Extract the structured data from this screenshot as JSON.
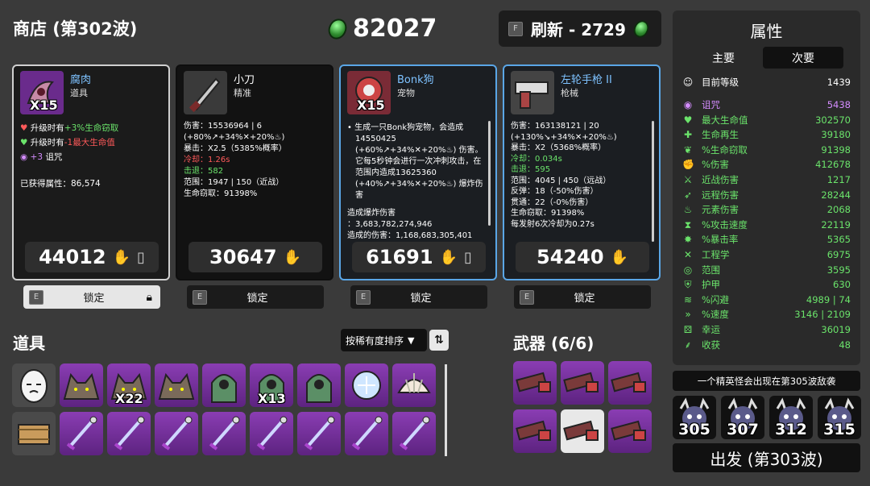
{
  "shop": {
    "title": "商店 (第302波)"
  },
  "gold": {
    "amount": "82027",
    "icon": "green-material-icon"
  },
  "refresh": {
    "key": "F",
    "label": "刷新 - 2729"
  },
  "cards": [
    {
      "name": "腐肉",
      "type": "道具",
      "qty": "X15",
      "rarity": "white",
      "lines": [
        {
          "prefix": "升级时有",
          "value": "+3%生命窃取",
          "value_color": "green",
          "icon": "heart-drain-icon"
        },
        {
          "prefix": "升级时有",
          "value": "-1最大生命值",
          "value_color": "red",
          "icon": "heart-icon"
        },
        {
          "prefix": "+3",
          "value": "诅咒",
          "value_color": "white",
          "icon": "curse-icon"
        }
      ],
      "acquired": "已获得属性：86,574",
      "price": "44012"
    },
    {
      "name": "小刀",
      "type": "精准",
      "rarity": "black",
      "stats": [
        "伤害：15536964 | 6 (+80%↗+34%✕+20%♨)",
        "暴击：X2.5（5385%概率）",
        "冷却：1.26s",
        "击退：582",
        "范围：1947 | 150（近战）",
        "生命窃取：91398%"
      ],
      "price": "30647"
    },
    {
      "name": "Bonk狗",
      "type": "宠物",
      "qty": "X15",
      "rarity": "blue",
      "desc": "生成一只Bonk狗宠物，会造成14550425 (+60%↗+34%✕+20%♨) 伤害。它每5秒钟会进行一次冲刺攻击，在范围内造成13625360 (+40%↗+34%✕+20%♨) 爆炸伤害",
      "dmg_title": "造成爆炸伤害",
      "dmg_value": "：3,683,782,274,946",
      "dealt": "造成的伤害：1,168,683,305,401",
      "price": "61691"
    },
    {
      "name": "左轮手枪 II",
      "type": "枪械",
      "rarity": "blue",
      "stats": [
        "伤害：163138121 | 20 (+130%↘+34%✕+20%♨)",
        "暴击：X2（5368%概率）",
        "冷却：0.034s",
        "击退：595",
        "范围：4045 | 450（远战）",
        "反弹：18（-50%伤害）",
        "贯通：22（-0%伤害）",
        "生命窃取：91398%",
        "每发射6次冷却为0.27s"
      ],
      "price": "54240"
    }
  ],
  "lock": {
    "key": "E",
    "label": "锁定"
  },
  "items_section": {
    "title": "道具",
    "sort_label": "按稀有度排序"
  },
  "weapons_section": {
    "title": "武器 (6/6)"
  },
  "items_row1": [
    {
      "icon": "egg-face-icon",
      "qty": ""
    },
    {
      "icon": "werewolf-icon",
      "qty": ""
    },
    {
      "icon": "werewolf-icon",
      "qty": "X22"
    },
    {
      "icon": "werewolf-icon",
      "qty": ""
    },
    {
      "icon": "green-ghost-icon",
      "qty": ""
    },
    {
      "icon": "green-ghost-icon",
      "qty": "X13"
    },
    {
      "icon": "green-ghost-icon",
      "qty": ""
    },
    {
      "icon": "snowball-icon",
      "qty": ""
    },
    {
      "icon": "shell-icon",
      "qty": ""
    }
  ],
  "items_row2": [
    {
      "icon": "hay-bale-icon"
    },
    {
      "icon": "sword-icon"
    },
    {
      "icon": "sword-icon"
    },
    {
      "icon": "sword-icon"
    },
    {
      "icon": "sword-icon"
    },
    {
      "icon": "sword-icon"
    },
    {
      "icon": "sword-icon"
    },
    {
      "icon": "sword-icon"
    },
    {
      "icon": "sword-icon"
    }
  ],
  "weapons": [
    {
      "icon": "chainsaw-icon"
    },
    {
      "icon": "chainsaw-icon"
    },
    {
      "icon": "chainsaw-icon"
    },
    {
      "icon": "chainsaw-icon"
    },
    {
      "icon": "chainsaw-icon",
      "selected": true
    },
    {
      "icon": "chainsaw-icon"
    }
  ],
  "stats_panel": {
    "title": "属性",
    "tab_main": "主要",
    "tab_secondary": "次要",
    "level_label": "目前等级",
    "level_value": "1439",
    "rows": [
      {
        "name": "诅咒",
        "value": "5438",
        "color": "#d48cff",
        "icon": "curse-icon"
      },
      {
        "name": "最大生命值",
        "value": "302570",
        "color": "#6be46b",
        "icon": "heart-icon"
      },
      {
        "name": "生命再生",
        "value": "39180",
        "color": "#6be46b",
        "icon": "regen-icon"
      },
      {
        "name": "%生命窃取",
        "value": "91398",
        "color": "#6be46b",
        "icon": "lifesteal-icon"
      },
      {
        "name": "%伤害",
        "value": "412678",
        "color": "#6be46b",
        "icon": "damage-icon"
      },
      {
        "name": "近战伤害",
        "value": "1217",
        "color": "#6be46b",
        "icon": "melee-icon"
      },
      {
        "name": "远程伤害",
        "value": "28244",
        "color": "#6be46b",
        "icon": "ranged-icon"
      },
      {
        "name": "元素伤害",
        "value": "2068",
        "color": "#6be46b",
        "icon": "elemental-icon"
      },
      {
        "name": "%攻击速度",
        "value": "22119",
        "color": "#6be46b",
        "icon": "attack-speed-icon"
      },
      {
        "name": "%暴击率",
        "value": "5365",
        "color": "#6be46b",
        "icon": "crit-icon"
      },
      {
        "name": "工程学",
        "value": "6975",
        "color": "#6be46b",
        "icon": "engineering-icon"
      },
      {
        "name": "范围",
        "value": "3595",
        "color": "#6be46b",
        "icon": "range-icon"
      },
      {
        "name": "护甲",
        "value": "630",
        "color": "#6be46b",
        "icon": "armor-icon"
      },
      {
        "name": "%闪避",
        "value": "4989 | 74",
        "color": "#6be46b",
        "icon": "dodge-icon"
      },
      {
        "name": "%速度",
        "value": "3146 | 2109",
        "color": "#6be46b",
        "icon": "speed-icon"
      },
      {
        "name": "幸运",
        "value": "36019",
        "color": "#6be46b",
        "icon": "luck-icon"
      },
      {
        "name": "收获",
        "value": "48",
        "color": "#6be46b",
        "icon": "harvest-icon"
      }
    ]
  },
  "elite_notice": "一个精英怪会出现在第305波敌袭",
  "boss_waves": [
    "305",
    "307",
    "312",
    "315"
  ],
  "go_button": "出发 (第303波)"
}
